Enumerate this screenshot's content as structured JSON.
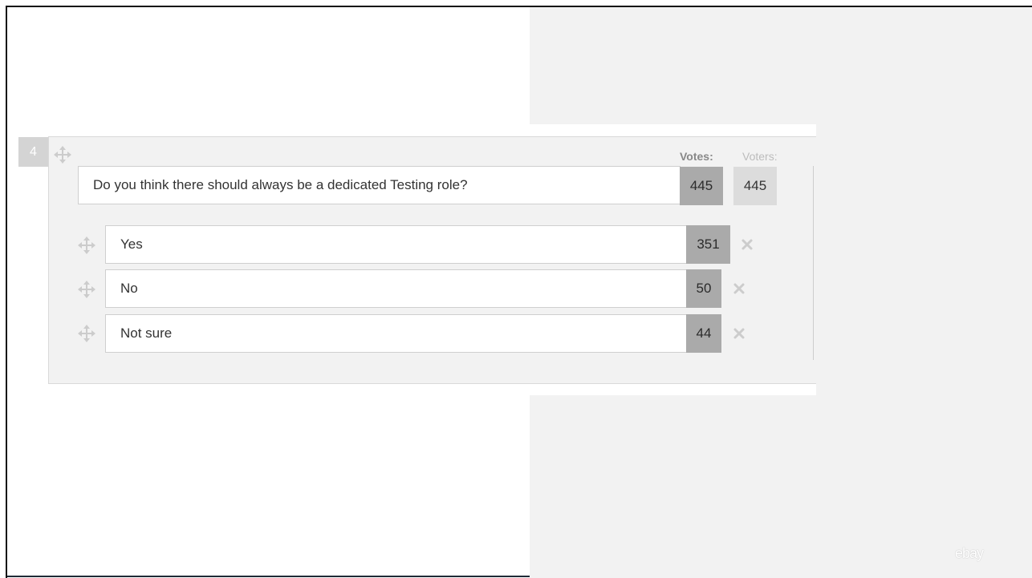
{
  "question": {
    "number": "4",
    "text": "Do you think there should always be a dedicated Testing role?",
    "votes_header": "Votes:",
    "voters_header": "Voters:",
    "votes": "445",
    "voters": "445"
  },
  "options": [
    {
      "label": "Yes",
      "votes": "351"
    },
    {
      "label": "No",
      "votes": "50"
    },
    {
      "label": "Not sure",
      "votes": "44"
    }
  ],
  "icons": {
    "move": "move-icon",
    "remove": "close-icon"
  },
  "watermark": "ebay",
  "colors": {
    "panel": "#f2f2f2",
    "count_box": "#aaaaaa",
    "voters_box": "#dcdcdc",
    "icon": "#cccccc"
  }
}
